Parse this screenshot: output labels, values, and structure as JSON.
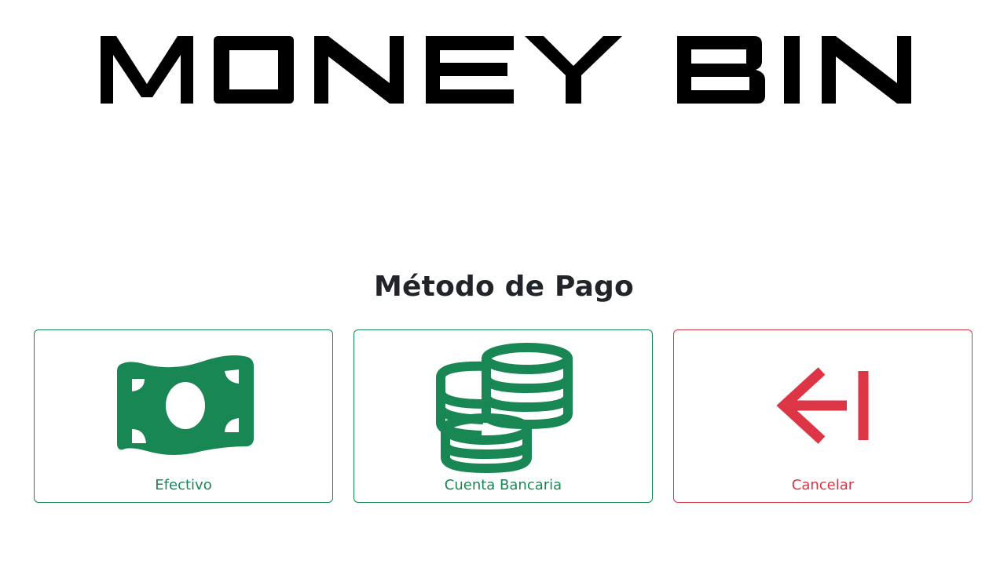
{
  "logo": {
    "text": "MONEY BIN"
  },
  "page_title": "Método de Pago",
  "options": [
    {
      "label": "Efectivo",
      "icon": "cash-icon",
      "color": "#198754"
    },
    {
      "label": "Cuenta Bancaria",
      "icon": "coins-icon",
      "color": "#198754"
    },
    {
      "label": "Cancelar",
      "icon": "arrow-bar-left-icon",
      "color": "#dc3545"
    }
  ],
  "colors": {
    "success": "#198754",
    "danger": "#dc3545",
    "text": "#212529"
  }
}
